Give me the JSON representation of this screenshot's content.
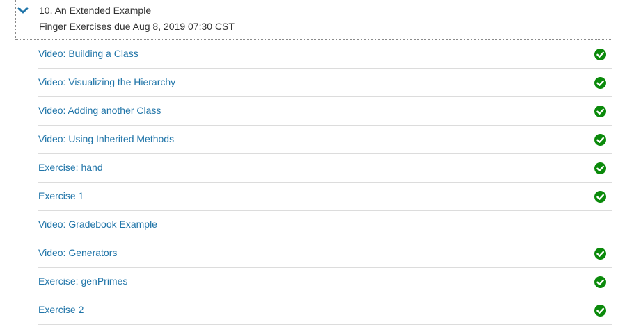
{
  "section": {
    "title": "10. An Extended Example",
    "due": "Finger Exercises due Aug 8, 2019 07:30 CST",
    "expanded_icon": "chevron-down-icon",
    "accent_color": "#1f74a8"
  },
  "items": [
    {
      "label": "Video: Building a Class",
      "completed": true
    },
    {
      "label": "Video: Visualizing the Hierarchy",
      "completed": true
    },
    {
      "label": "Video: Adding another Class",
      "completed": true
    },
    {
      "label": "Video: Using Inherited Methods",
      "completed": true
    },
    {
      "label": "Exercise: hand",
      "completed": true
    },
    {
      "label": "Exercise 1",
      "completed": true
    },
    {
      "label": "Video: Gradebook Example",
      "completed": false
    },
    {
      "label": "Video: Generators",
      "completed": true
    },
    {
      "label": "Exercise: genPrimes",
      "completed": true
    },
    {
      "label": "Exercise 2",
      "completed": true
    }
  ],
  "colors": {
    "check_green": "#0b8a0b",
    "link_blue": "#1f74a8",
    "text_dark": "#313131"
  }
}
